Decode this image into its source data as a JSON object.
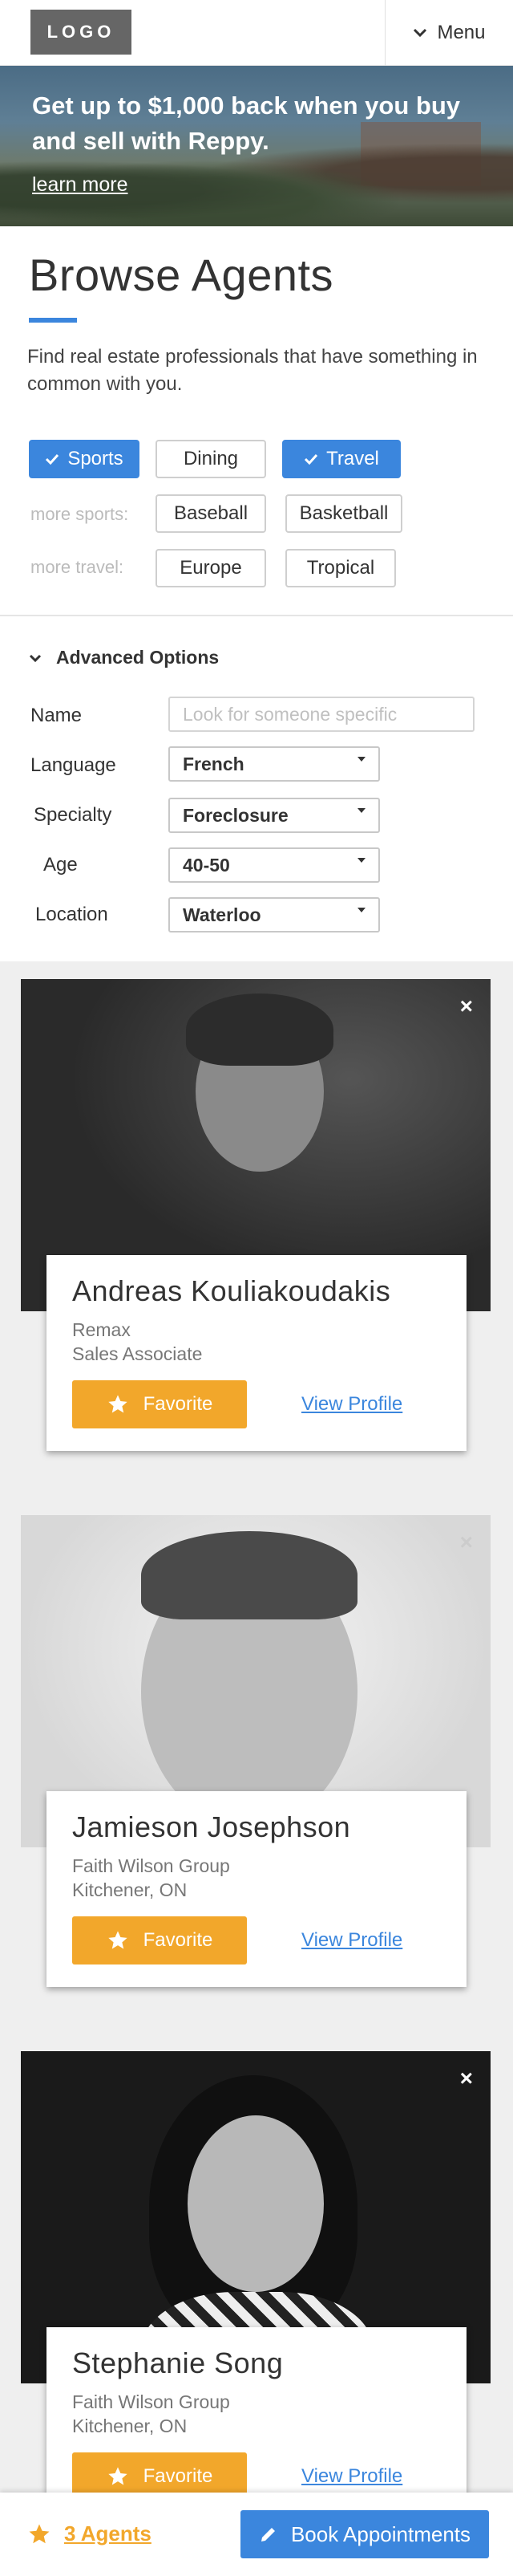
{
  "header": {
    "logo": "LOGO",
    "menu_label": "Menu"
  },
  "hero": {
    "title": "Get up to $1,000 back when you buy and sell with Reppy.",
    "link": "learn more"
  },
  "browse": {
    "title": "Browse Agents",
    "intro": "Find real estate professionals that have something in common with you.",
    "interests": [
      {
        "label": "Sports",
        "selected": true
      },
      {
        "label": "Dining",
        "selected": false
      },
      {
        "label": "Travel",
        "selected": true
      }
    ],
    "more_sports_label": "more sports:",
    "more_sports": [
      "Baseball",
      "Basketball"
    ],
    "more_travel_label": "more travel:",
    "more_travel": [
      "Europe",
      "Tropical"
    ]
  },
  "advanced": {
    "heading": "Advanced Options",
    "name_label": "Name",
    "name_placeholder": "Look for someone specific",
    "language_label": "Language",
    "language_value": "French",
    "specialty_label": "Specialty",
    "specialty_value": "Foreclosure",
    "age_label": "Age",
    "age_value": "40-50",
    "location_label": "Location",
    "location_value": "Waterloo"
  },
  "agents": [
    {
      "name": "Andreas Kouliakoudakis",
      "line1": "Remax",
      "line2": "Sales Associate",
      "favorite_label": "Favorite",
      "profile_label": "View Profile",
      "close": "×"
    },
    {
      "name": "Jamieson Josephson",
      "line1": "Faith Wilson Group",
      "line2": "Kitchener, ON",
      "favorite_label": "Favorite",
      "profile_label": "View Profile",
      "close": "×"
    },
    {
      "name": "Stephanie Song",
      "line1": "Faith Wilson Group",
      "line2": "Kitchener, ON",
      "favorite_label": "Favorite",
      "profile_label": "View Profile",
      "close": "×"
    }
  ],
  "bottom_bar": {
    "agents_count": "3 Agents",
    "book_label": "Book Appointments"
  },
  "colors": {
    "accent_blue": "#3b86dd",
    "favorite_orange": "#f2a72b"
  }
}
